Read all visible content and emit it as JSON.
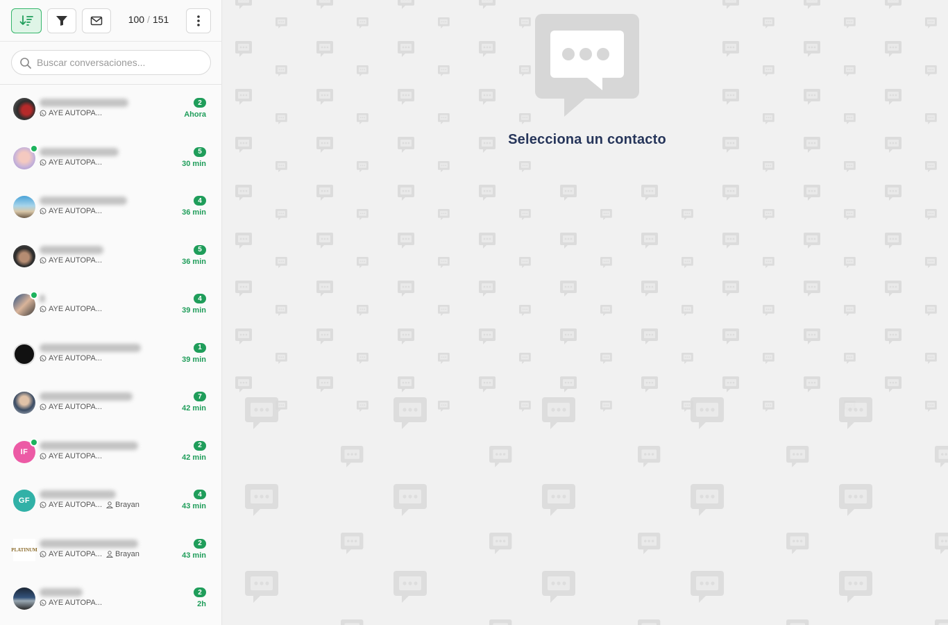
{
  "toolbar": {
    "sort_icon": "sort-desc-icon",
    "filter_icon": "filter-icon",
    "mail_icon": "mail-icon",
    "more_icon": "more-vertical-icon",
    "count_current": "100",
    "count_separator": "/",
    "count_total": "151"
  },
  "search": {
    "placeholder": "Buscar conversaciones..."
  },
  "conversations": [
    {
      "channel": "AYE AUTOPA...",
      "agent": "",
      "unread": "2",
      "time": "Ahora"
    },
    {
      "channel": "AYE AUTOPA...",
      "agent": "",
      "unread": "5",
      "time": "30 min"
    },
    {
      "channel": "AYE AUTOPA...",
      "agent": "",
      "unread": "4",
      "time": "36 min"
    },
    {
      "channel": "AYE AUTOPA...",
      "agent": "",
      "unread": "5",
      "time": "36 min"
    },
    {
      "channel": "AYE AUTOPA...",
      "agent": "",
      "unread": "4",
      "time": "39 min"
    },
    {
      "channel": "AYE AUTOPA...",
      "agent": "",
      "unread": "1",
      "time": "39 min"
    },
    {
      "channel": "AYE AUTOPA...",
      "agent": "",
      "unread": "7",
      "time": "42 min"
    },
    {
      "channel": "AYE AUTOPA...",
      "agent": "",
      "unread": "2",
      "time": "42 min",
      "initials": "IF"
    },
    {
      "channel": "AYE AUTOPA...",
      "agent": "Brayan",
      "unread": "4",
      "time": "43 min",
      "initials": "GF"
    },
    {
      "channel": "AYE AUTOPA...",
      "agent": "Brayan",
      "unread": "2",
      "time": "43 min",
      "logo_text": "PLATINUM"
    },
    {
      "channel": "AYE AUTOPA...",
      "agent": "",
      "unread": "2",
      "time": "2h"
    }
  ],
  "main": {
    "empty_title": "Selecciona un contacto",
    "empty_icon": "chat-bubble-icon"
  },
  "colors": {
    "accent": "#1f9d5a",
    "title": "#26355a",
    "pink": "#ec5aa5",
    "teal": "#31b1a7"
  }
}
